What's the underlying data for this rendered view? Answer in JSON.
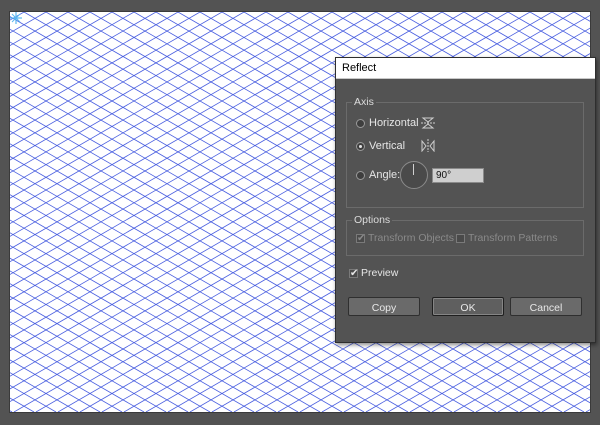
{
  "dialog": {
    "title": "Reflect",
    "axis": {
      "label": "Axis",
      "options": [
        {
          "label": "Horizontal",
          "checked": false,
          "icon": "reflect-horizontal-icon"
        },
        {
          "label": "Vertical",
          "checked": true,
          "icon": "reflect-vertical-icon"
        },
        {
          "label": "Angle:",
          "checked": false
        }
      ],
      "angle_value": "90°"
    },
    "options": {
      "label": "Options",
      "transform_objects": {
        "label": "Transform Objects",
        "checked": true,
        "enabled": false
      },
      "transform_patterns": {
        "label": "Transform Patterns",
        "checked": false,
        "enabled": false
      }
    },
    "preview": {
      "label": "Preview",
      "checked": true
    },
    "buttons": {
      "copy": "Copy",
      "ok": "OK",
      "cancel": "Cancel"
    }
  },
  "canvas": {
    "grid": "isometric",
    "line_color": "#4a5fe0",
    "background": "#ffffff"
  },
  "colors": {
    "workspace": "#535353",
    "accent_center": "#5ab8f0"
  }
}
